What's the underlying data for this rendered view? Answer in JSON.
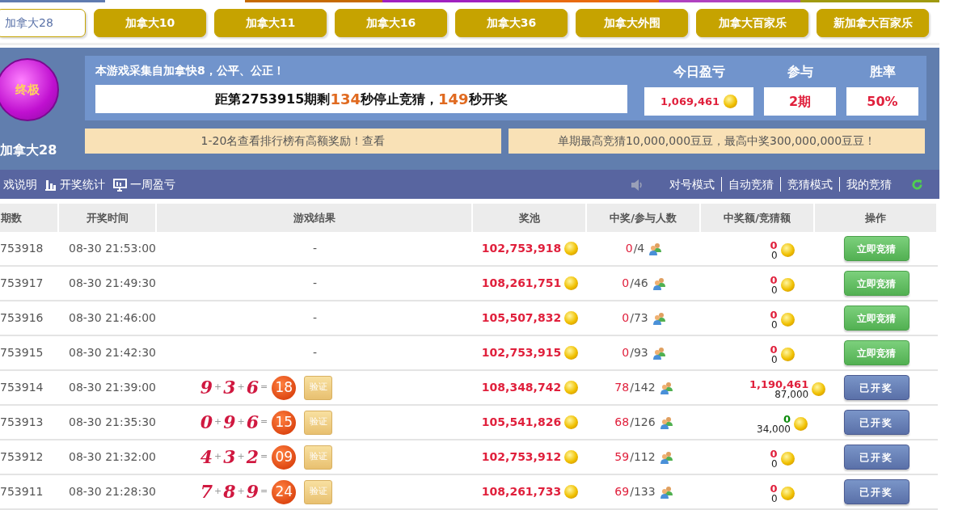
{
  "game_tabs": [
    {
      "label": "加拿大28",
      "selected": true
    },
    {
      "label": "加拿大10",
      "selected": false
    },
    {
      "label": "加拿大11",
      "selected": false
    },
    {
      "label": "加拿大16",
      "selected": false
    },
    {
      "label": "加拿大36",
      "selected": false
    },
    {
      "label": "加拿大外围",
      "selected": false
    },
    {
      "label": "加拿大百家乐",
      "selected": false
    },
    {
      "label": "新加拿大百家乐",
      "selected": false
    }
  ],
  "logo": {
    "badge": "终极",
    "name": "加拿大28"
  },
  "info": {
    "notice": "本游戏采集自加拿快8，公平、公正！",
    "countdown": "距第2753915期剩**134**秒停止竞猜，**149**秒开奖",
    "stats": [
      {
        "label": "今日盈亏",
        "value": "1,069,461",
        "coin": true
      },
      {
        "label": "参与",
        "value": "2期",
        "coin": false
      },
      {
        "label": "胜率",
        "value": "50%",
        "coin": false
      }
    ]
  },
  "banners": [
    "1-20名查看排行榜有高额奖励！查看",
    "单期最高竞猜10,000,000豆豆，最高中奖300,000,000豆豆！"
  ],
  "toolbar": {
    "left": [
      {
        "label": "戏说明"
      },
      {
        "label": "开奖统计"
      },
      {
        "label": "一周盈亏"
      }
    ],
    "right": [
      "对号模式",
      "自动竞猜",
      "竞猜模式",
      "我的竞猜"
    ]
  },
  "table": {
    "columns": [
      "期数",
      "开奖时间",
      "游戏结果",
      "奖池",
      "中奖/参与人数",
      "中奖额/竞猜额",
      "操作"
    ],
    "rows": [
      {
        "issue": "753918",
        "time": "08-30 21:53:00",
        "result": "-",
        "pool": "102,753,918",
        "winners": "0",
        "players": "/4",
        "win": "0",
        "color": "#e0203c",
        "bet": "0",
        "action": {
          "kind": "bet",
          "label": "立即竞猜"
        }
      },
      {
        "issue": "753917",
        "time": "08-30 21:49:30",
        "result": "-",
        "pool": "108,261,751",
        "winners": "0",
        "players": "/46",
        "win": "0",
        "color": "#e0203c",
        "bet": "0",
        "action": {
          "kind": "bet",
          "label": "立即竞猜"
        }
      },
      {
        "issue": "753916",
        "time": "08-30 21:46:00",
        "result": "-",
        "pool": "105,507,832",
        "winners": "0",
        "players": "/73",
        "win": "0",
        "color": "#e0203c",
        "bet": "0",
        "action": {
          "kind": "bet",
          "label": "立即竞猜"
        }
      },
      {
        "issue": "753915",
        "time": "08-30 21:42:30",
        "result": "-",
        "pool": "102,753,915",
        "winners": "0",
        "players": "/93",
        "win": "0",
        "color": "#e0203c",
        "bet": "0",
        "action": {
          "kind": "bet",
          "label": "立即竞猜"
        }
      },
      {
        "issue": "753914",
        "time": "08-30 21:39:00",
        "result": {
          "digits": [
            "9",
            "3",
            "6"
          ],
          "signs": [
            "+",
            "+",
            "="
          ],
          "sum": "18",
          "verify": "验证"
        },
        "pool": "108,348,742",
        "winners": "78",
        "players": "/142",
        "win": "1,190,461",
        "color": "#e0203c",
        "bet": "87,000",
        "action": {
          "kind": "opened",
          "label": "已开奖"
        }
      },
      {
        "issue": "753913",
        "time": "08-30 21:35:30",
        "result": {
          "digits": [
            "0",
            "9",
            "6"
          ],
          "signs": [
            "+",
            "+",
            "="
          ],
          "sum": "15",
          "verify": "验证"
        },
        "pool": "105,541,826",
        "winners": "68",
        "players": "/126",
        "win": "0",
        "color": "#0a8a0a",
        "bet": "34,000",
        "action": {
          "kind": "opened",
          "label": "已开奖"
        }
      },
      {
        "issue": "753912",
        "time": "08-30 21:32:00",
        "result": {
          "digits": [
            "4",
            "3",
            "2"
          ],
          "signs": [
            "+",
            "+",
            "="
          ],
          "sum": "09",
          "verify": "验证"
        },
        "pool": "102,753,912",
        "winners": "59",
        "players": "/112",
        "win": "0",
        "color": "#e0203c",
        "bet": "0",
        "action": {
          "kind": "opened",
          "label": "已开奖"
        }
      },
      {
        "issue": "753911",
        "time": "08-30 21:28:30",
        "result": {
          "digits": [
            "7",
            "8",
            "9"
          ],
          "signs": [
            "+",
            "+",
            "="
          ],
          "sum": "24",
          "verify": "验证"
        },
        "pool": "108,261,733",
        "winners": "69",
        "players": "/133",
        "win": "0",
        "color": "#e0203c",
        "bet": "0",
        "action": {
          "kind": "opened",
          "label": "已开奖"
        }
      }
    ]
  }
}
